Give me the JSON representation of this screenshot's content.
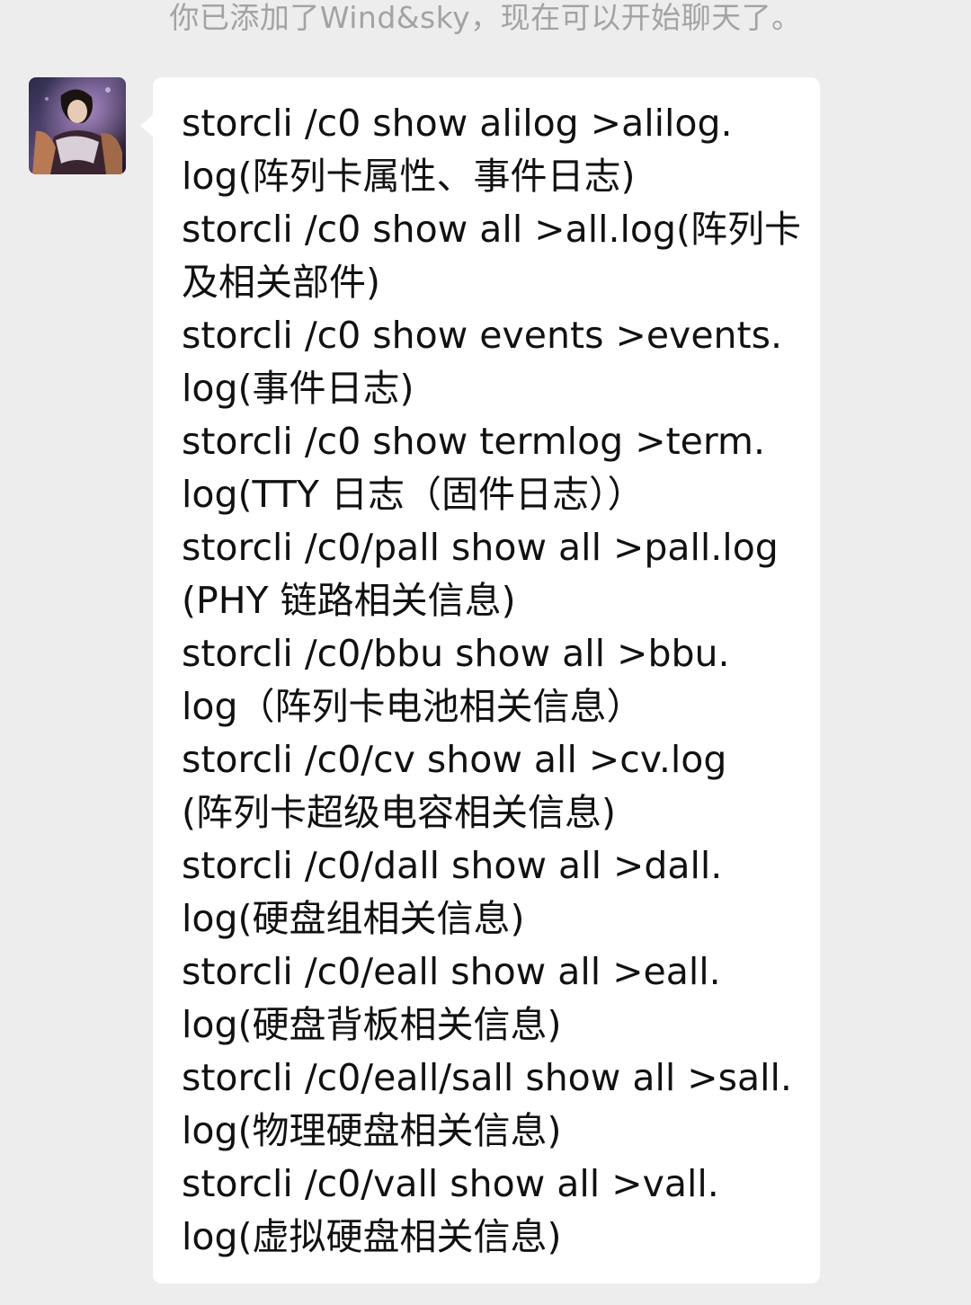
{
  "chat": {
    "system_notice": "你已添加了Wind&sky，现在可以开始聊天了。",
    "message": {
      "lines": [
        "storcli /c0 show alilog >alilog.",
        "log(阵列卡属性、事件日志)",
        "storcli /c0 show all >all.log(阵列卡",
        "及相关部件)",
        "storcli /c0 show events >events.",
        "log(事件日志)",
        "storcli /c0 show termlog >term.",
        "log(TTY 日志（固件日志））",
        "storcli /c0/pall show all >pall.log",
        "(PHY 链路相关信息)",
        "storcli /c0/bbu show all >bbu.",
        "log（阵列卡电池相关信息）",
        "storcli /c0/cv show all >cv.log",
        "(阵列卡超级电容相关信息)",
        "storcli /c0/dall show all >dall.",
        "log(硬盘组相关信息)",
        "storcli /c0/eall show all >eall.",
        "log(硬盘背板相关信息)",
        "storcli /c0/eall/sall show all >sall.",
        "log(物理硬盘相关信息)",
        "storcli /c0/vall show all >vall.",
        "log(虚拟硬盘相关信息)"
      ]
    }
  },
  "colors": {
    "background": "#ededed",
    "bubble": "#ffffff",
    "notice_text": "#a3a3a3",
    "message_text": "#111111"
  }
}
